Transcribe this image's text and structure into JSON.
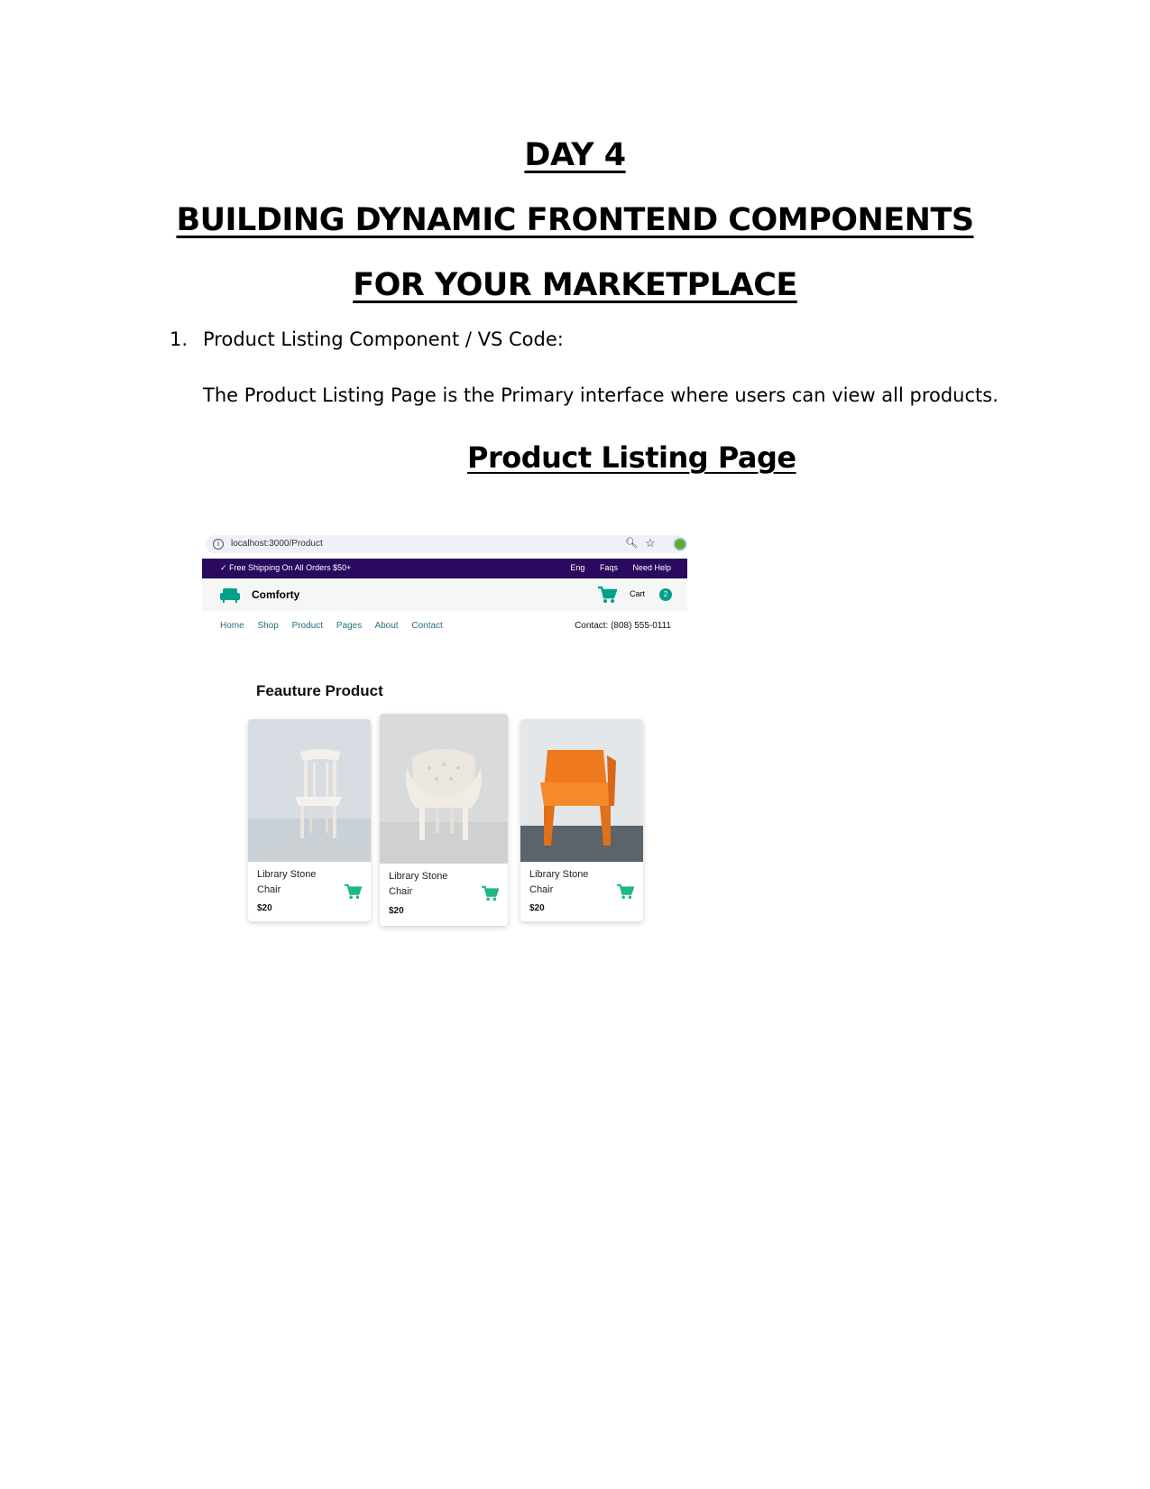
{
  "document": {
    "title_line1": "DAY 4",
    "title_line2": "BUILDING DYNAMIC FRONTEND COMPONENTS",
    "title_line3": "FOR YOUR MARKETPLACE",
    "list_number": "1.",
    "list_item": "Product Listing Component / VS Code:",
    "paragraph": "The Product Listing Page is the Primary interface where users can view all products.",
    "section_heading": "Product Listing Page"
  },
  "screenshot": {
    "browser": {
      "url": "localhost:3000/Product"
    },
    "topbar": {
      "shipping": "✓ Free Shipping On All Orders $50+",
      "links": [
        "Eng",
        "Faqs",
        "Need Help"
      ],
      "bg_color": "#2a0a5e"
    },
    "brandbar": {
      "brand": "Comforty",
      "cart_label": "Cart",
      "cart_count": "2",
      "accent": "#029f8a"
    },
    "nav": {
      "items": [
        "Home",
        "Shop",
        "Product",
        "Pages",
        "About",
        "Contact"
      ],
      "contact": "Contact: (808) 555-0111"
    },
    "featured": {
      "title": "Feauture Product",
      "products": [
        {
          "name": "Library Stone Chair",
          "price": "$20",
          "image": "white-wooden-chair"
        },
        {
          "name": "Library Stone Chair",
          "price": "$20",
          "image": "white-tufted-armchair"
        },
        {
          "name": "Library Stone Chair",
          "price": "$20",
          "image": "orange-plastic-chair"
        }
      ]
    }
  }
}
